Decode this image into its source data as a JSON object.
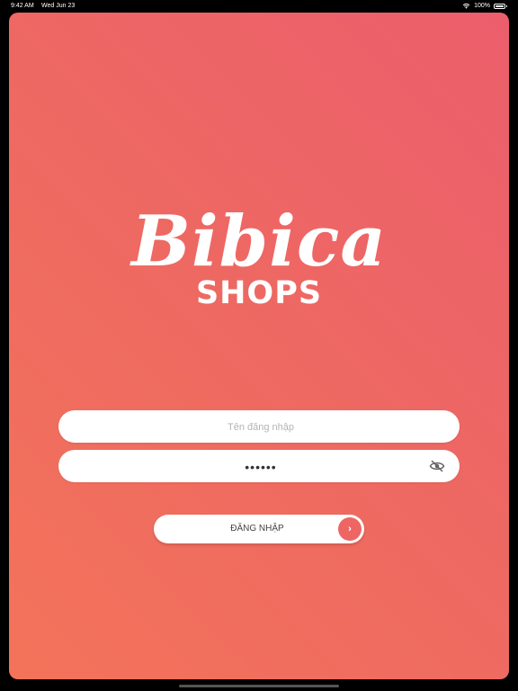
{
  "status": {
    "time": "9:42 AM",
    "date": "Wed Jun 23",
    "battery": "100%"
  },
  "logo": {
    "brand": "Bibica",
    "sub": "SHOPS"
  },
  "form": {
    "username_placeholder": "Tên đăng nhập",
    "username_value": "",
    "password_value": "••••••",
    "login_label": "ĐĂNG NHẬP",
    "login_arrow": "›"
  },
  "colors": {
    "gradient_top": "#ec5e6c",
    "gradient_bottom": "#f3735a",
    "accent": "#ee6664"
  },
  "icons": [
    "wifi-icon",
    "battery-icon",
    "eye-off-icon",
    "chevron-right-icon"
  ]
}
